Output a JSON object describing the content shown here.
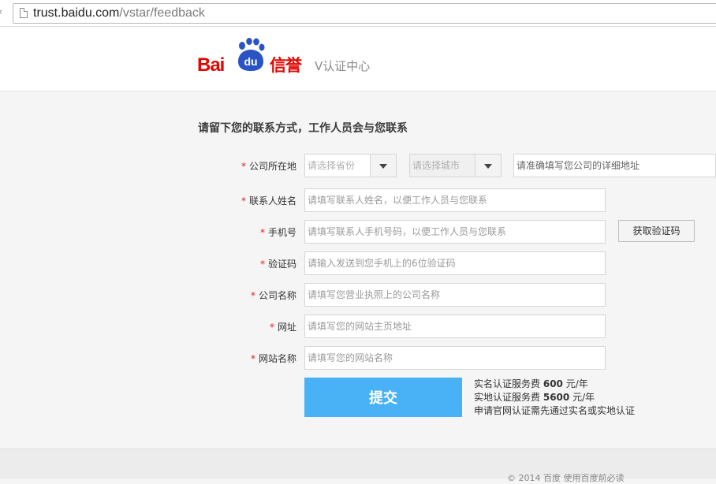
{
  "browser": {
    "url_host": "trust.baidu.com",
    "url_path": "/vstar/feedback"
  },
  "header": {
    "logo_bai": "Bai",
    "logo_du": "du",
    "logo_brand": "信誉",
    "subtitle": "V认证中心"
  },
  "form": {
    "title": "请留下您的联系方式，工作人员会与您联系",
    "required_mark": "*",
    "location": {
      "label": "公司所在地",
      "province_placeholder": "请选择省份",
      "city_placeholder": "请选择城市",
      "address_placeholder": "请准确填写您公司的详细地址"
    },
    "contact_name": {
      "label": "联系人姓名",
      "placeholder": "请填写联系人姓名，以便工作人员与您联系"
    },
    "phone": {
      "label": "手机号",
      "placeholder": "请填写联系人手机号码，以便工作人员与您联系",
      "get_code_label": "获取验证码"
    },
    "code": {
      "label": "验证码",
      "placeholder": "请输入发送到您手机上的6位验证码"
    },
    "company": {
      "label": "公司名称",
      "placeholder": "请填写您营业执照上的公司名称"
    },
    "website": {
      "label": "网址",
      "placeholder": "请填写您的网站主页地址"
    },
    "site_name": {
      "label": "网站名称",
      "placeholder": "请填写您的网站名称"
    },
    "submit_label": "提交",
    "fees": {
      "line1_prefix": "实名认证服务费",
      "line1_amount": "600",
      "line1_unit": "元/年",
      "line2_prefix": "实地认证服务费",
      "line2_amount": "5600",
      "line2_unit": "元/年",
      "line3": "申请官网认证需先通过实名或实地认证"
    }
  },
  "footer": {
    "copyright": "© 2014 百度 使用百度前必读"
  },
  "colors": {
    "brand_red": "#e10602",
    "brand_blue": "#2a54c6",
    "submit_blue": "#49b1f5",
    "required_red": "#e02020"
  }
}
